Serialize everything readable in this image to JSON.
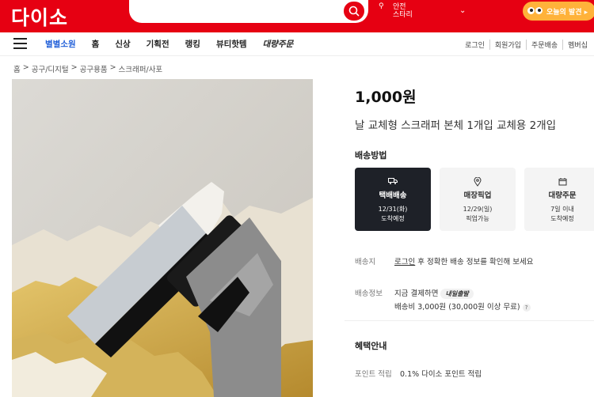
{
  "header": {
    "logo": "다이소",
    "search_placeholder": "",
    "location_line1": "안전",
    "location_line2": "스타리",
    "discover_label": "오늘의 발견 ▸"
  },
  "nav": {
    "items": [
      "별별소원",
      "홈",
      "신상",
      "기획전",
      "랭킹",
      "뷰티핫템",
      "대량주문"
    ],
    "util": [
      "로그인",
      "회원가입",
      "주문배송",
      "멤버십"
    ]
  },
  "breadcrumb": [
    "홈",
    "공구/디지털",
    "공구용품",
    "스크래퍼/사포"
  ],
  "breadcrumb_sep": ">",
  "product": {
    "price": "1,000원",
    "title": "날 교체형 스크래퍼 본체 1개입 교체용 2개입"
  },
  "delivery": {
    "section_title": "배송방법",
    "options": [
      {
        "name": "택배배송",
        "date": "12/31(화)",
        "note": "도착예정",
        "icon": "truck-icon",
        "selected": true
      },
      {
        "name": "매장픽업",
        "date": "12/29(일)",
        "note": "픽업가능",
        "icon": "location-pin-icon",
        "selected": false
      },
      {
        "name": "대량주문",
        "date": "7일 이내",
        "note": "도착예정",
        "icon": "box-icon",
        "selected": false
      }
    ]
  },
  "ship_to": {
    "label": "배송지",
    "link": "로그인",
    "text": " 후 정확한 배송 정보를 확인해 보세요"
  },
  "ship_info": {
    "label": "배송정보",
    "line1": "지금 결제하면",
    "badge": "내일출발",
    "line2": "배송비 3,000원 (30,000원 이상 무료)",
    "help": "?"
  },
  "benefits": {
    "section_title": "혜택안내",
    "label": "포인트 적립",
    "value": "0.1% 다이소 포인트 적립"
  },
  "colors": {
    "brand_red": "#e60012",
    "selected_dark": "#1e2128",
    "accent_orange": "#ffb23a"
  }
}
